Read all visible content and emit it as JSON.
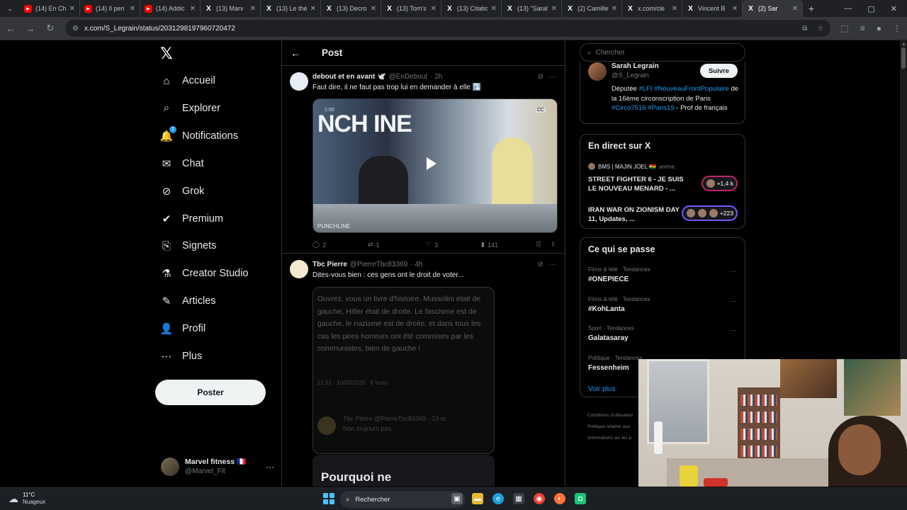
{
  "browser": {
    "tabs": [
      {
        "label": "(14) En Ch",
        "icon": "youtube-icon"
      },
      {
        "label": "(14) Il pen",
        "icon": "youtube-icon"
      },
      {
        "label": "(14) Addic",
        "icon": "youtube-icon"
      },
      {
        "label": "(13) Marv",
        "icon": "x-icon"
      },
      {
        "label": "(13) Le thé",
        "icon": "x-icon"
      },
      {
        "label": "(13) Decro",
        "icon": "x-icon"
      },
      {
        "label": "(13) Tom's",
        "icon": "x-icon"
      },
      {
        "label": "(13) Citatio",
        "icon": "x-icon"
      },
      {
        "label": "(13) \"Sarah",
        "icon": "x-icon"
      },
      {
        "label": "(2) Camille",
        "icon": "x-icon"
      },
      {
        "label": "x.com/cle",
        "icon": "x-icon"
      },
      {
        "label": "Vincent B",
        "icon": "x-icon"
      },
      {
        "label": "(2) Sar",
        "icon": "x-icon",
        "active": true
      }
    ],
    "url": "x.com/S_Legrain/status/2031298197960720472"
  },
  "nav": {
    "items": [
      {
        "label": "Accueil",
        "icon": "home-icon"
      },
      {
        "label": "Explorer",
        "icon": "search-icon"
      },
      {
        "label": "Notifications",
        "icon": "bell-icon",
        "badge": "2"
      },
      {
        "label": "Chat",
        "icon": "mail-icon"
      },
      {
        "label": "Grok",
        "icon": "grok-icon"
      },
      {
        "label": "Premium",
        "icon": "verified-icon"
      },
      {
        "label": "Signets",
        "icon": "bookmark-icon"
      },
      {
        "label": "Creator Studio",
        "icon": "flask-icon"
      },
      {
        "label": "Articles",
        "icon": "article-icon"
      },
      {
        "label": "Profil",
        "icon": "person-icon"
      },
      {
        "label": "Plus",
        "icon": "more-circle-icon"
      }
    ],
    "post_label": "Poster",
    "profile": {
      "name": "Marvel fitness 🇫🇷",
      "handle": "@Marvel_Flt"
    }
  },
  "main": {
    "title": "Post",
    "tweet1": {
      "name": "debout et en avant 🕊️",
      "handle": "@EnDebout",
      "time": "· 2h",
      "text": "Faut dire, il ne faut pas trop lui en demander à elle ⤵️",
      "video_text": "NCH INE",
      "video_time": "1:00",
      "video_cc": "CC",
      "video_lower": "PUNCHLINE",
      "replies": "2",
      "reposts": "1",
      "likes": "3",
      "views": "141"
    },
    "tweet2": {
      "name": "Tbc Pierre",
      "handle": "@PierreTbc83369",
      "time": "· 4h",
      "text": "Dites-vous bien : ces gens ont le droit de voter...",
      "quote_text": "Ouvrez, vous un livre d'histoire. Mussolini était de gauche, Hitler était de droite. Le fascisme est de gauche, le nazisme est de droite, et dans tous les cas les pires horreurs ont été commises par les communistes, bien de gauche !",
      "quote_meta": "21:01 · 10/03/2026 · 8 Vues",
      "quote_reply_name": "Tbc Pierre @PierreTbc83369 · 23 m",
      "quote_reply_text": "Non toujours pas.",
      "card_title": "Pourquoi ne"
    }
  },
  "right": {
    "search_placeholder": "Chercher",
    "bio": {
      "name": "Sarah Legrain",
      "handle": "@S_Legrain",
      "follow": "Suivre",
      "text_1": "Députée ",
      "tag_1": "#LFI",
      "tag_2": "#NouveauFrontPopulaire",
      "text_2": " de la 16ème circonscription de Paris ",
      "tag_3": "#Circo7516",
      "tag_4": "#Paris19",
      "text_3": " - Prof de français"
    },
    "live": {
      "title": "En direct sur X",
      "host": "BMS | MAJIN JOEL 🇬🇭",
      "host_suffix": "anime.",
      "items": [
        {
          "title": "STREET FIGHTER 6 - JE SUIS LE NOUVEAU MENARD - ...",
          "count": "+1,4 k"
        },
        {
          "title": "IRAN WAR ON ZIONISM DAY 11, Updates, ...",
          "count": "+223"
        }
      ]
    },
    "trends": {
      "title": "Ce qui se passe",
      "items": [
        {
          "context": "Films & télé · Tendances",
          "name": "#ONEPIECE"
        },
        {
          "context": "Films & télé · Tendances",
          "name": "#KohLanta"
        },
        {
          "context": "Sport · Tendances",
          "name": "Galatasaray"
        },
        {
          "context": "Politique · Tendances",
          "name": "Fessenheim"
        }
      ],
      "see_more": "Voir plus"
    },
    "footer": [
      "Conditions d'utilisation",
      "Politique relative aux",
      "Informations sur les p"
    ]
  },
  "taskbar": {
    "temp": "11°C",
    "condition": "Nuageux",
    "search": "Rechercher"
  },
  "colors": {
    "accent": "#1d9bf0",
    "background": "#000000",
    "border": "#2f3336",
    "muted": "#71767b"
  }
}
